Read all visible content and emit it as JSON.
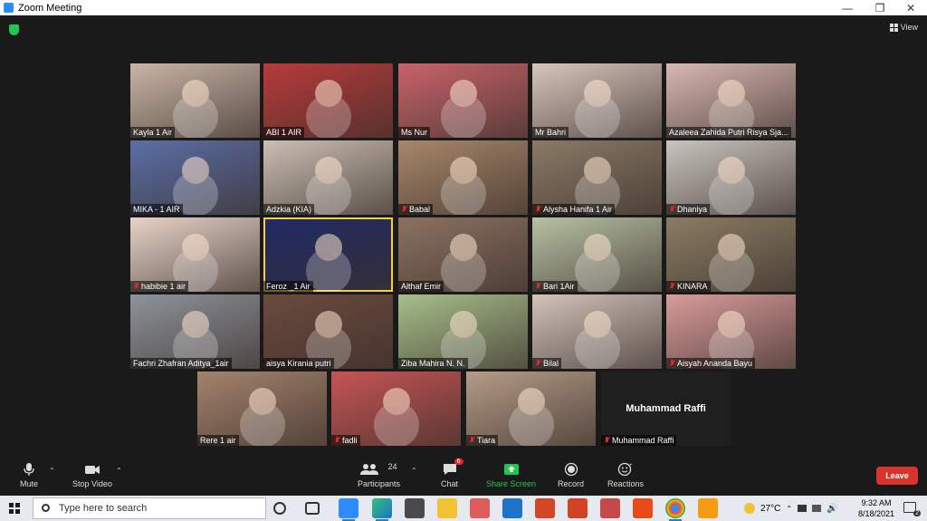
{
  "window": {
    "title": "Zoom Meeting"
  },
  "top": {
    "view_label": "View"
  },
  "participants": [
    {
      "name": "Kayla 1 Air",
      "muted": false,
      "bg": "#c9b5a6"
    },
    {
      "name": "ABI 1 AIR",
      "muted": false,
      "bg": "#b83a3a"
    },
    {
      "name": "Ms Nur",
      "muted": false,
      "bg": "#c9636a"
    },
    {
      "name": "Mr Bahri",
      "muted": false,
      "bg": "#d8c6bd"
    },
    {
      "name": "Azaleea Zahida Putri Risya Sja...",
      "muted": false,
      "bg": "#d9b8b2"
    },
    {
      "name": "MIKA - 1 AIR",
      "muted": false,
      "bg": "#5a6ea6"
    },
    {
      "name": "Adzkia (KIA)",
      "muted": false,
      "bg": "#cbbfb3"
    },
    {
      "name": "Babal",
      "muted": true,
      "bg": "#a8876a"
    },
    {
      "name": "Alysha Hanifa 1 Air",
      "muted": true,
      "bg": "#8a7a66"
    },
    {
      "name": "Dhaniya",
      "muted": true,
      "bg": "#c9c4bf"
    },
    {
      "name": "habibie 1 air",
      "muted": true,
      "bg": "#e7d4c8"
    },
    {
      "name": "Feroz _1 Air",
      "muted": false,
      "bg": "#1f2a66"
    },
    {
      "name": "Althaf Emir",
      "muted": false,
      "bg": "#8b7261"
    },
    {
      "name": "Bari 1Air",
      "muted": true,
      "bg": "#b7c1a3"
    },
    {
      "name": "KINARA",
      "muted": true,
      "bg": "#8a7c63"
    },
    {
      "name": "Fachri Zhafran Aditya_1air",
      "muted": false,
      "bg": "#8e939a"
    },
    {
      "name": "aisya Kirania putri",
      "muted": false,
      "bg": "#6b4a3e"
    },
    {
      "name": "Ziba Mahira N. N.",
      "muted": false,
      "bg": "#a7bf8a"
    },
    {
      "name": "Bilal",
      "muted": true,
      "bg": "#d2c3bb"
    },
    {
      "name": "Aisyah Ananda Bayu",
      "muted": true,
      "bg": "#d99c9b"
    },
    {
      "name": "Rere 1 air",
      "muted": false,
      "bg": "#a4836d"
    },
    {
      "name": "fadli",
      "muted": true,
      "bg": "#c65454"
    },
    {
      "name": "Tiara",
      "muted": true,
      "bg": "#b49b86"
    },
    {
      "name": "Muhammad Raffi",
      "muted": true,
      "bg": "#1f1f1f",
      "name_only": true
    }
  ],
  "toolbar": {
    "mute_label": "Mute",
    "video_label": "Stop Video",
    "participants_label": "Participants",
    "participants_count": "24",
    "chat_label": "Chat",
    "chat_badge": "6",
    "share_label": "Share Screen",
    "record_label": "Record",
    "reactions_label": "Reactions",
    "leave_label": "Leave"
  },
  "taskbar": {
    "search_placeholder": "Type here to search",
    "temperature": "27°C",
    "time": "9:32 AM",
    "date": "8/18/2021",
    "notifications": "2"
  },
  "colors": {
    "accent": "#2d8cff",
    "leave": "#d9342b",
    "share": "#23c552",
    "active_speaker": "#f4d03f"
  }
}
